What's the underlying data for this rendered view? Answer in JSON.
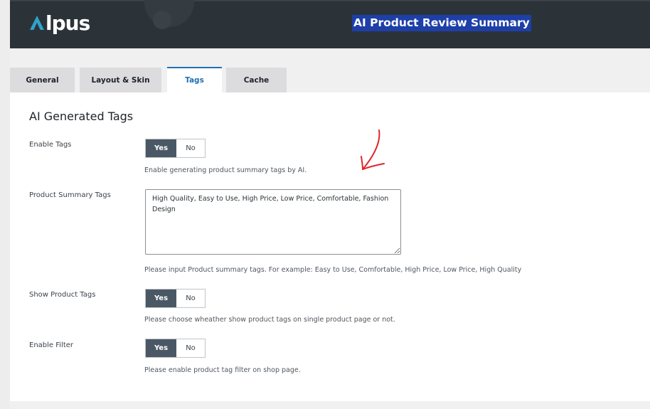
{
  "header": {
    "logo_text": "lpus",
    "logo_letter": "A",
    "title": "AI Product Review Summary"
  },
  "tabs": [
    {
      "label": "General",
      "active": false
    },
    {
      "label": "Layout & Skin",
      "active": false
    },
    {
      "label": "Tags",
      "active": true
    },
    {
      "label": "Cache",
      "active": false
    }
  ],
  "section": {
    "title": "AI Generated Tags"
  },
  "fields": {
    "enable_tags": {
      "label": "Enable Tags",
      "yes": "Yes",
      "no": "No",
      "selected": "Yes",
      "help": "Enable generating product summary tags by AI."
    },
    "summary_tags": {
      "label": "Product Summary Tags",
      "value": "High Quality, Easy to Use, High Price, Low Price, Comfortable, Fashion Design",
      "help": "Please input Product summary tags. For example: Easy to Use, Comfortable, High Price, Low Price, High Quality"
    },
    "show_tags": {
      "label": "Show Product Tags",
      "yes": "Yes",
      "no": "No",
      "selected": "Yes",
      "help": "Please choose wheather show product tags on single product page or not."
    },
    "enable_filter": {
      "label": "Enable Filter",
      "yes": "Yes",
      "no": "No",
      "selected": "Yes",
      "help": "Please enable product tag filter on shop page."
    }
  },
  "colors": {
    "header_bg": "#2c3338",
    "logo_accent": "#2ea2cc",
    "title_highlight": "#1e3fa8",
    "toggle_active": "#4a5866",
    "tab_active_border": "#2271b1",
    "annotation_arrow": "#e0262a"
  },
  "annotation": {
    "icon": "hand-drawn-arrow-icon"
  }
}
